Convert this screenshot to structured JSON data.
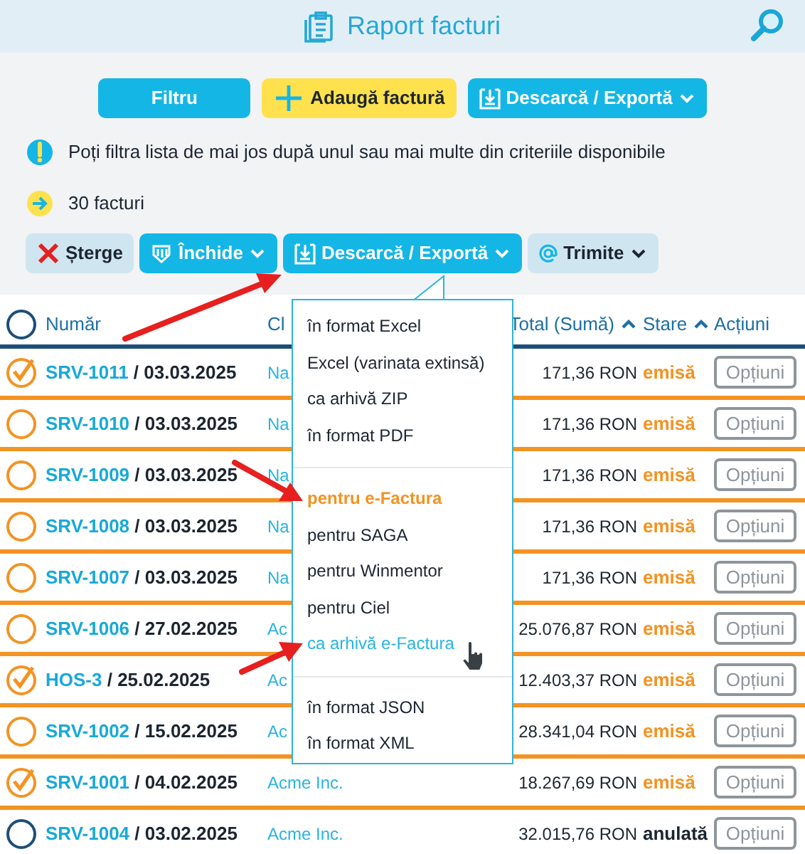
{
  "header": {
    "title": "Raport facturi"
  },
  "toolbar": [
    {
      "label": "Filtru",
      "kind": "cyan",
      "dropdown": false
    },
    {
      "label": "Adaugă factură",
      "kind": "yellow",
      "dropdown": false
    },
    {
      "label": "Descarcă / Exportă",
      "kind": "cyan",
      "dropdown": true
    }
  ],
  "info": "Poți filtra lista de mai jos după unul sau mai multe din criteriile disponibile",
  "count": "30 facturi",
  "actions": [
    {
      "label": "Șterge",
      "kind": "pale",
      "dropdown": false
    },
    {
      "label": "Închide",
      "kind": "cyan",
      "dropdown": true
    },
    {
      "label": "Descarcă / Exportă",
      "kind": "cyan",
      "dropdown": true
    },
    {
      "label": "Trimite",
      "kind": "pale",
      "dropdown": true
    }
  ],
  "table": {
    "select_all": false,
    "columns": [
      {
        "label": "Număr",
        "sorted": false
      },
      {
        "label": "Cl",
        "sorted": false
      },
      {
        "label": "Total (Sumă)",
        "sorted": true
      },
      {
        "label": "Stare",
        "sorted": true
      },
      {
        "label": "Acțiuni",
        "sorted": false
      }
    ],
    "rows": [
      {
        "number": "SRV-1011",
        "date": " / 03.03.2025",
        "client": "Na",
        "total": "171,36 RON",
        "status": "emisă",
        "kind": "issued",
        "checked": true,
        "action": "Opțiuni"
      },
      {
        "number": "SRV-1010",
        "date": " / 03.03.2025",
        "client": "Na",
        "total": "171,36 RON",
        "status": "emisă",
        "kind": "issued",
        "checked": false,
        "action": "Opțiuni"
      },
      {
        "number": "SRV-1009",
        "date": " / 03.03.2025",
        "client": "Na",
        "total": "171,36 RON",
        "status": "emisă",
        "kind": "issued",
        "checked": false,
        "action": "Opțiuni"
      },
      {
        "number": "SRV-1008",
        "date": " / 03.03.2025",
        "client": "Na",
        "total": "171,36 RON",
        "status": "emisă",
        "kind": "issued",
        "checked": false,
        "action": "Opțiuni"
      },
      {
        "number": "SRV-1007",
        "date": " / 03.03.2025",
        "client": "Na",
        "total": "171,36 RON",
        "status": "emisă",
        "kind": "issued",
        "checked": false,
        "action": "Opțiuni"
      },
      {
        "number": "SRV-1006",
        "date": " / 27.02.2025",
        "client": "Ac",
        "total": "25.076,87 RON",
        "status": "emisă",
        "kind": "issued",
        "checked": false,
        "action": "Opțiuni"
      },
      {
        "number": "HOS-3",
        "date": " / 25.02.2025",
        "client": "Ac",
        "total": "12.403,37 RON",
        "status": "emisă",
        "kind": "issued",
        "checked": true,
        "action": "Opțiuni"
      },
      {
        "number": "SRV-1002",
        "date": " / 15.02.2025",
        "client": "Ac",
        "total": "28.341,04 RON",
        "status": "emisă",
        "kind": "issued",
        "checked": false,
        "action": "Opțiuni"
      },
      {
        "number": "SRV-1001",
        "date": " / 04.02.2025",
        "client": "Acme Inc.",
        "total": "18.267,69 RON",
        "status": "emisă",
        "kind": "issued",
        "checked": true,
        "action": "Opțiuni"
      },
      {
        "number": "SRV-1004",
        "date": " / 03.02.2025",
        "client": "Acme Inc.",
        "total": "32.015,76 RON",
        "status": "anulată",
        "kind": "cancelled",
        "checked": false,
        "action": "Opțiuni"
      }
    ]
  },
  "export_menu": {
    "groups": [
      [
        {
          "label": "în format Excel",
          "kind": "normal",
          "hovered": false
        },
        {
          "label": "Excel (varinata extinsă)",
          "kind": "normal",
          "hovered": false
        },
        {
          "label": "ca arhivă ZIP",
          "kind": "normal",
          "hovered": false
        },
        {
          "label": "în format PDF",
          "kind": "normal",
          "hovered": false
        }
      ],
      [
        {
          "label": "pentru e-Factura",
          "kind": "featured",
          "hovered": false
        },
        {
          "label": "pentru SAGA",
          "kind": "normal",
          "hovered": false
        },
        {
          "label": "pentru Winmentor",
          "kind": "normal",
          "hovered": false
        },
        {
          "label": "pentru Ciel",
          "kind": "normal",
          "hovered": false
        },
        {
          "label": "ca arhivă e-Factura",
          "kind": "normal",
          "hovered": true
        }
      ],
      [
        {
          "label": "în format JSON",
          "kind": "normal",
          "hovered": false
        },
        {
          "label": "în format XML",
          "kind": "normal",
          "hovered": false
        }
      ]
    ]
  }
}
